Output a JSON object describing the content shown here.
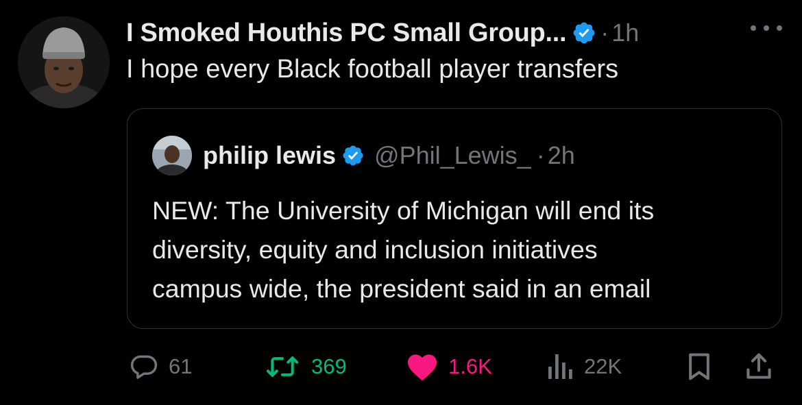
{
  "post": {
    "author_name": "I Smoked Houthis PC Small Group...",
    "separator": "·",
    "time": "1h",
    "text": "I hope every Black football player transfers"
  },
  "quoted_post": {
    "author_name": "philip lewis",
    "handle": "@Phil_Lewis_",
    "separator": "·",
    "time": "2h",
    "text_lines": [
      "NEW: The University of Michigan will end its",
      "diversity, equity and inclusion initiatives",
      "campus wide, the president said in an email"
    ]
  },
  "actions": {
    "replies": "61",
    "reposts": "369",
    "likes": "1.6K",
    "views": "22K"
  },
  "colors": {
    "background": "#000000",
    "text_primary": "#e7e9ea",
    "text_secondary": "#71767b",
    "verified": "#1d9bf0",
    "repost_active": "#00ba7c",
    "like_active": "#f91880",
    "quote_border": "#2f3336"
  },
  "icons": [
    "verified-badge-icon",
    "more-icon",
    "reply-icon",
    "repost-icon",
    "like-icon",
    "views-icon",
    "bookmark-icon",
    "share-icon"
  ]
}
